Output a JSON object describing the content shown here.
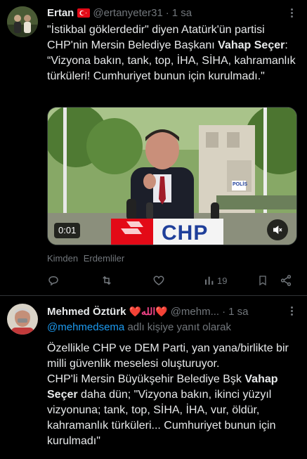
{
  "tweet1": {
    "author_name": "Ertan",
    "handle": "@ertanyeter31",
    "separator": "·",
    "time": "1 sa",
    "text_plain": "\"İstikbal göklerdedir\" diyen Atatürk'ün partisi CHP'nin Mersin Belediye Başkanı ",
    "text_bold": "Vahap Seçer",
    "text_rest": ": “Vizyona bakın, tank, top, İHA, SİHA, kahramanlık türküleri! Cumhuriyet bunun için kurulmadı.\"",
    "video": {
      "duration": "0:01",
      "podium_logo": "CHP",
      "sign_text": "POLİS"
    },
    "from_label": "Kimden",
    "from_source": "Erdemliler",
    "views_count": "19"
  },
  "tweet2": {
    "author_name": "Mehmed Öztürk",
    "name_decoration": "❤️الله❤️",
    "handle": "@mehm...",
    "separator": "·",
    "time": "1 sa",
    "reply_mention": "@mehmedsema",
    "reply_suffix": " adlı kişiye yanıt olarak",
    "line1": "Özellikle CHP ve DEM Parti, yan yana/birlikte bir milli güvenlik meselesi oluşturuyor.",
    "line2_plain": "CHP'li Mersin Büyükşehir Belediye Bşk ",
    "line2_bold": "Vahap Seçer",
    "line2_rest": " daha dün; \"Vizyona bakın, ikinci yüzyıl vizyonuna; tank, top, SİHA, İHA, vur, öldür, kahramanlık türküleri... Cumhuriyet bunun için kurulmadı\""
  },
  "colors": {
    "background": "#000000",
    "text": "#e7e9ea",
    "secondary": "#71767b",
    "link": "#1d9bf0",
    "divider": "#2f3336",
    "chp_red": "#e30a17"
  },
  "icons": [
    "turkey-flag-icon",
    "more-icon",
    "reply-icon",
    "retweet-icon",
    "like-icon",
    "views-icon",
    "bookmark-icon",
    "share-icon",
    "mute-icon",
    "heart-emoji-icon"
  ]
}
